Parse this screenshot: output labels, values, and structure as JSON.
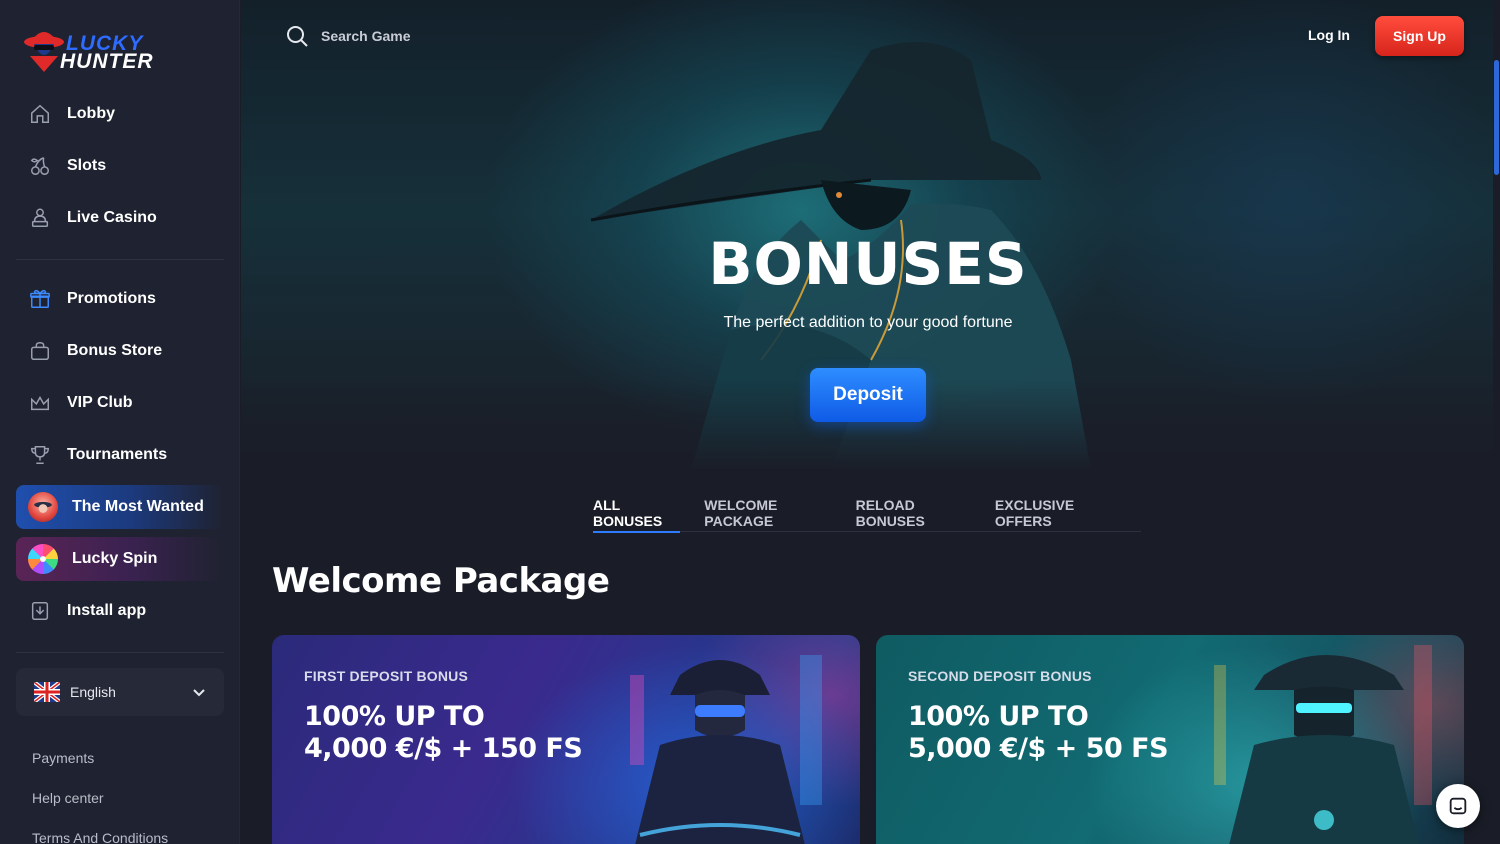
{
  "brand": {
    "line1": "LUCKY",
    "line2": "HUNTER"
  },
  "sidebar": {
    "items": [
      {
        "label": "Lobby",
        "icon": "home-icon"
      },
      {
        "label": "Slots",
        "icon": "cherry-icon"
      },
      {
        "label": "Live Casino",
        "icon": "dealer-icon"
      },
      {
        "label": "Promotions",
        "icon": "gift-icon"
      },
      {
        "label": "Bonus Store",
        "icon": "bag-icon"
      },
      {
        "label": "VIP Club",
        "icon": "crown-icon"
      },
      {
        "label": "Tournaments",
        "icon": "trophy-icon"
      },
      {
        "label": "The Most Wanted",
        "icon": "most-wanted-icon"
      },
      {
        "label": "Lucky Spin",
        "icon": "wheel-icon"
      },
      {
        "label": "Install app",
        "icon": "download-icon"
      }
    ],
    "language": {
      "label": "English",
      "icon": "uk-flag-icon"
    },
    "footer_links": [
      "Payments",
      "Help center",
      "Terms And Conditions"
    ]
  },
  "header": {
    "search_placeholder": "Search Game",
    "login_label": "Log In",
    "signup_label": "Sign Up"
  },
  "hero": {
    "title": "BONUSES",
    "subtitle": "The perfect addition to your good fortune",
    "deposit_label": "Deposit"
  },
  "tabs": [
    {
      "label": "ALL BONUSES",
      "active": true
    },
    {
      "label": "WELCOME PACKAGE",
      "active": false
    },
    {
      "label": "RELOAD BONUSES",
      "active": false
    },
    {
      "label": "EXCLUSIVE OFFERS",
      "active": false
    }
  ],
  "section": {
    "title": "Welcome Package"
  },
  "cards": [
    {
      "label": "FIRST DEPOSIT BONUS",
      "line1": "100% UP TO",
      "line2": "4,000 €/$ + 150 FS"
    },
    {
      "label": "SECOND DEPOSIT BONUS",
      "line1": "100% UP TO",
      "line2": "5,000 €/$ + 50 FS"
    }
  ],
  "colors": {
    "accent_blue": "#2f7bff",
    "signup_red": "#e8322a",
    "background": "#1a1d27",
    "sidebar": "#1f2230"
  }
}
